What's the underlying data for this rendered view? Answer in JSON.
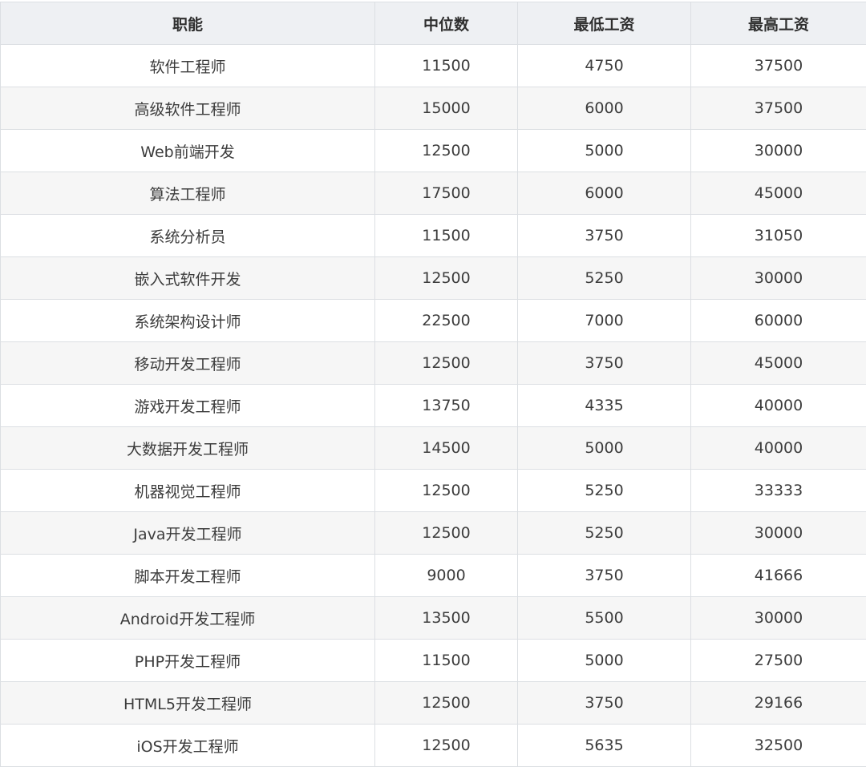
{
  "table": {
    "headers": [
      "职能",
      "中位数",
      "最低工资",
      "最高工资"
    ],
    "rows": [
      [
        "软件工程师",
        "11500",
        "4750",
        "37500"
      ],
      [
        "高级软件工程师",
        "15000",
        "6000",
        "37500"
      ],
      [
        "Web前端开发",
        "12500",
        "5000",
        "30000"
      ],
      [
        "算法工程师",
        "17500",
        "6000",
        "45000"
      ],
      [
        "系统分析员",
        "11500",
        "3750",
        "31050"
      ],
      [
        "嵌入式软件开发",
        "12500",
        "5250",
        "30000"
      ],
      [
        "系统架构设计师",
        "22500",
        "7000",
        "60000"
      ],
      [
        "移动开发工程师",
        "12500",
        "3750",
        "45000"
      ],
      [
        "游戏开发工程师",
        "13750",
        "4335",
        "40000"
      ],
      [
        "大数据开发工程师",
        "14500",
        "5000",
        "40000"
      ],
      [
        "机器视觉工程师",
        "12500",
        "5250",
        "33333"
      ],
      [
        "Java开发工程师",
        "12500",
        "5250",
        "30000"
      ],
      [
        "脚本开发工程师",
        "9000",
        "3750",
        "41666"
      ],
      [
        "Android开发工程师",
        "13500",
        "5500",
        "30000"
      ],
      [
        "PHP开发工程师",
        "11500",
        "5000",
        "27500"
      ],
      [
        "HTML5开发工程师",
        "12500",
        "3750",
        "29166"
      ],
      [
        "iOS开发工程师",
        "12500",
        "5635",
        "32500"
      ]
    ]
  }
}
